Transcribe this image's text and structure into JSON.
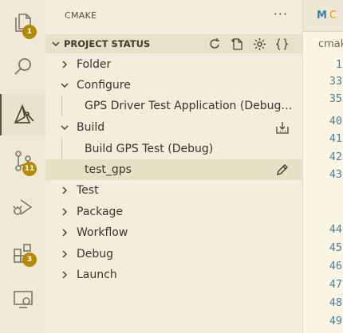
{
  "activity_bar": {
    "explorer_badge": "1",
    "source_control_badge": "11",
    "extensions_badge": "3"
  },
  "side_bar": {
    "title": "CMAKE",
    "more_label": "···",
    "section": {
      "title": "PROJECT STATUS",
      "actions": [
        "refresh",
        "new-file",
        "settings",
        "json"
      ]
    },
    "tree": [
      {
        "label": "Folder",
        "expanded": false
      },
      {
        "label": "Configure",
        "expanded": true
      },
      {
        "label": "GPS Driver Test Application (Debug)..."
      },
      {
        "label": "Build",
        "expanded": true
      },
      {
        "label": "Build GPS Test (Debug)"
      },
      {
        "label": "test_gps",
        "selected": true
      },
      {
        "label": "Test",
        "expanded": false
      },
      {
        "label": "Package",
        "expanded": false
      },
      {
        "label": "Workflow",
        "expanded": false
      },
      {
        "label": "Debug",
        "expanded": false
      },
      {
        "label": "Launch",
        "expanded": false
      }
    ]
  },
  "editor": {
    "tab_icon": "M",
    "tab_label": "C",
    "breadcrumb": "cmak",
    "line_numbers": [
      "1",
      "33",
      "35",
      "40",
      "41",
      "42",
      "43",
      "44",
      "45",
      "46",
      "47",
      "48",
      "49"
    ]
  }
}
